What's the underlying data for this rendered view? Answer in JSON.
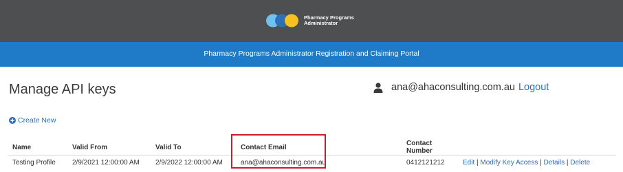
{
  "header": {
    "logo_line1": "Pharmacy Programs",
    "logo_line2": "Administrator",
    "portal_title": "Pharmacy Programs Administrator Registration and Claiming Portal"
  },
  "colors": {
    "topbar": "#4e4f50",
    "bluebar": "#1f7bc7",
    "link": "#2a6ebb",
    "highlight": "#d0182c",
    "logo_light_blue": "#6fc2ee",
    "logo_blue": "#2c6fba",
    "logo_yellow": "#f7c21f"
  },
  "page": {
    "title": "Manage API keys"
  },
  "user": {
    "icon": "user-icon",
    "email": "ana@ahaconsulting.com.au",
    "logout_label": "Logout"
  },
  "actions": {
    "create_new_icon": "plus-circle-icon",
    "create_new_label": "Create New"
  },
  "table": {
    "headers": {
      "name": "Name",
      "valid_from": "Valid From",
      "valid_to": "Valid To",
      "contact_email": "Contact Email",
      "contact_number": "Contact Number",
      "actions": ""
    },
    "rows": [
      {
        "name": "Testing Profile",
        "valid_from": "2/9/2021 12:00:00 AM",
        "valid_to": "2/9/2022 12:00:00 AM",
        "contact_email": "ana@ahaconsulting.com.au",
        "contact_number": "0412121212",
        "edit_label": "Edit",
        "modify_label": "Modify Key Access",
        "details_label": "Details",
        "delete_label": "Delete",
        "separator": "|"
      }
    ]
  }
}
